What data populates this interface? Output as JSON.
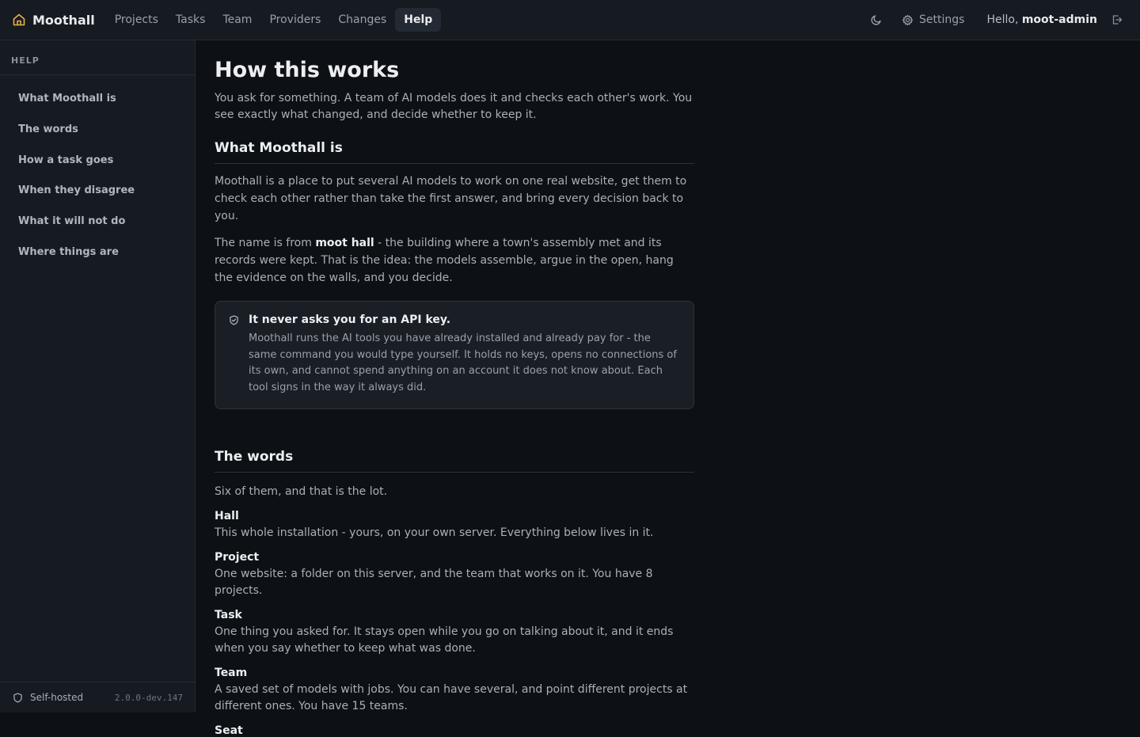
{
  "header": {
    "brand": "Moothall",
    "nav": [
      "Projects",
      "Tasks",
      "Team",
      "Providers",
      "Changes",
      "Help"
    ],
    "active_nav": "Help",
    "settings_label": "Settings",
    "hello_prefix": "Hello,",
    "username": "moot-admin"
  },
  "sidebar": {
    "heading": "HELP",
    "items": [
      "What Moothall is",
      "The words",
      "How a task goes",
      "When they disagree",
      "What it will not do",
      "Where things are"
    ],
    "footer_label": "Self-hosted",
    "version": "2.0.0-dev.147"
  },
  "main": {
    "title": "How this works",
    "lead": "You ask for something. A team of AI models does it and checks each other's work. You see exactly what changed, and decide whether to keep it.",
    "section1": {
      "heading": "What Moothall is",
      "p1": "Moothall is a place to put several AI models to work on one real website, get them to check each other rather than take the first answer, and bring every decision back to you.",
      "p2_before": "The name is from",
      "p2_bold": "moot hall",
      "p2_after": "- the building where a town's assembly met and its records were kept. That is the idea: the models assemble, argue in the open, hang the evidence on the walls, and you decide.",
      "callout_title": "It never asks you for an API key.",
      "callout_body": "Moothall runs the AI tools you have already installed and already pay for - the same command you would type yourself. It holds no keys, opens no connections of its own, and cannot spend anything on an account it does not know about. Each tool signs in the way it always did."
    },
    "section2": {
      "heading": "The words",
      "intro": "Six of them, and that is the lot.",
      "terms": [
        {
          "term": "Hall",
          "def": "This whole installation - yours, on your own server. Everything below lives in it."
        },
        {
          "term": "Project",
          "def": "One website: a folder on this server, and the team that works on it. You have 8 projects."
        },
        {
          "term": "Task",
          "def": "One thing you asked for. It stays open while you go on talking about it, and it ends when you say whether to keep what was done."
        },
        {
          "term": "Team",
          "def": "A saved set of models with jobs. You can have several, and point different projects at different ones. You have 15 teams."
        },
        {
          "term": "Seat",
          "def": ""
        }
      ]
    }
  },
  "colors": {
    "accent": "#e8b04a",
    "background": "#0d1014",
    "panel": "#161a21"
  }
}
